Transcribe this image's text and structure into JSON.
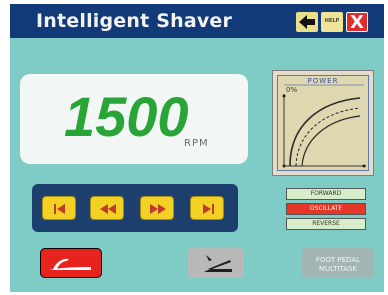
{
  "titlebar": {
    "title": "Intelligent Shaver",
    "help_label": "HELP",
    "close_label": "X"
  },
  "speed": {
    "value": "1500",
    "unit": "RPM"
  },
  "power": {
    "label": "POWER",
    "percent": "0%"
  },
  "transport": {
    "buttons": [
      "skip-to-start",
      "rewind",
      "fast-forward",
      "skip-to-end"
    ]
  },
  "modes": [
    {
      "label": "FORWARD",
      "selected": false
    },
    {
      "label": "OSCILLATE",
      "selected": true
    },
    {
      "label": "REVERSE",
      "selected": false
    }
  ],
  "multitask": {
    "line1": "FOOT PEDAL",
    "line2": "MULTITASK"
  },
  "colors": {
    "title_bar": "#123a78",
    "background": "#7fcbc6",
    "rpm_text": "#29a437",
    "transport_button": "#f3d024",
    "mode_selected": "#e53727",
    "power_button": "#e7231d"
  }
}
